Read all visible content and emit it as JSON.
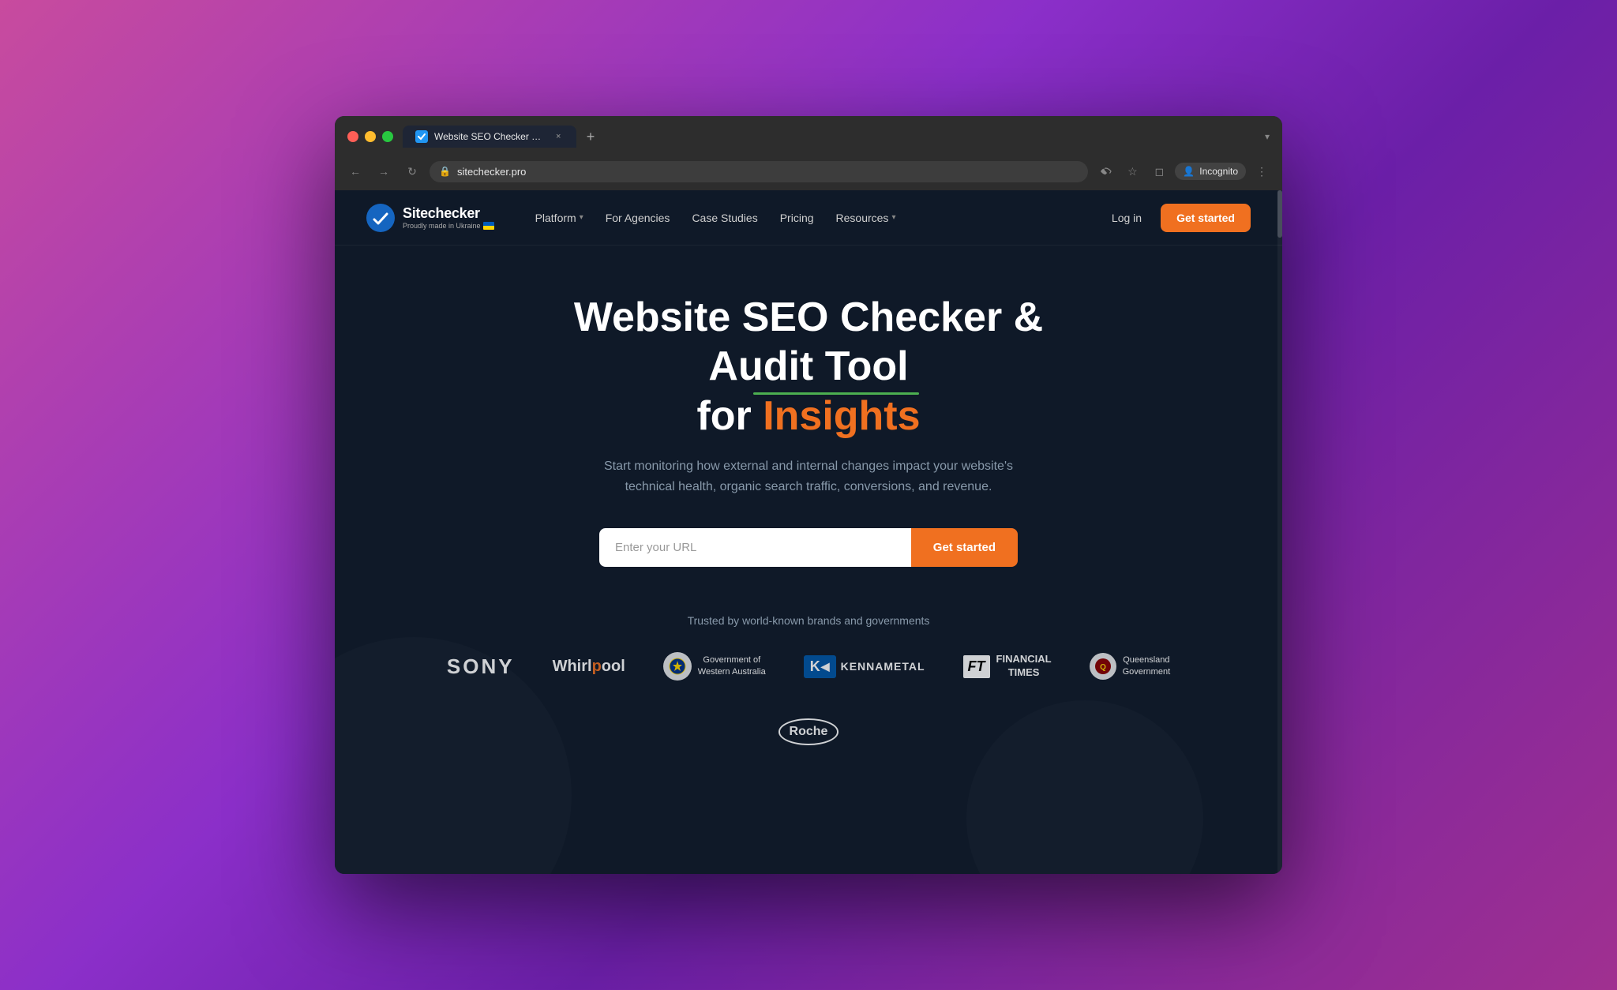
{
  "browser": {
    "tab_title": "Website SEO Checker & Audi...",
    "tab_favicon": "✓",
    "address": "sitechecker.pro",
    "incognito_label": "Incognito"
  },
  "nav": {
    "logo_name": "Sitechecker",
    "logo_tagline": "Proudly made in Ukraine",
    "platform_label": "Platform",
    "agencies_label": "For Agencies",
    "case_studies_label": "Case Studies",
    "pricing_label": "Pricing",
    "resources_label": "Resources",
    "login_label": "Log in",
    "get_started_label": "Get started"
  },
  "hero": {
    "title_part1": "Website SEO Checker & Audit Tool",
    "title_part2": "for ",
    "title_highlight": "Insights",
    "subtitle": "Start monitoring how external and internal changes impact your website's technical health, organic search traffic, conversions, and revenue.",
    "url_placeholder": "Enter your URL",
    "cta_label": "Get started"
  },
  "trust": {
    "label": "Trusted by world-known brands and governments",
    "logos": [
      {
        "id": "sony",
        "name": "Sony",
        "display": "SONY"
      },
      {
        "id": "whirlpool",
        "name": "Whirlpool",
        "display": "Whirlpool"
      },
      {
        "id": "govwa",
        "name": "Government of Western Australia",
        "line1": "Government of",
        "line2": "Western Australia"
      },
      {
        "id": "kennametal",
        "name": "Kennametal",
        "display": "KENNAMETAL"
      },
      {
        "id": "ft",
        "name": "Financial Times",
        "abbr": "FT",
        "line1": "FINANCIAL",
        "line2": "TIMES"
      },
      {
        "id": "qld",
        "name": "Queensland Government",
        "line1": "Queensland",
        "line2": "Government"
      },
      {
        "id": "roche",
        "name": "Roche",
        "display": "Roche"
      }
    ]
  }
}
